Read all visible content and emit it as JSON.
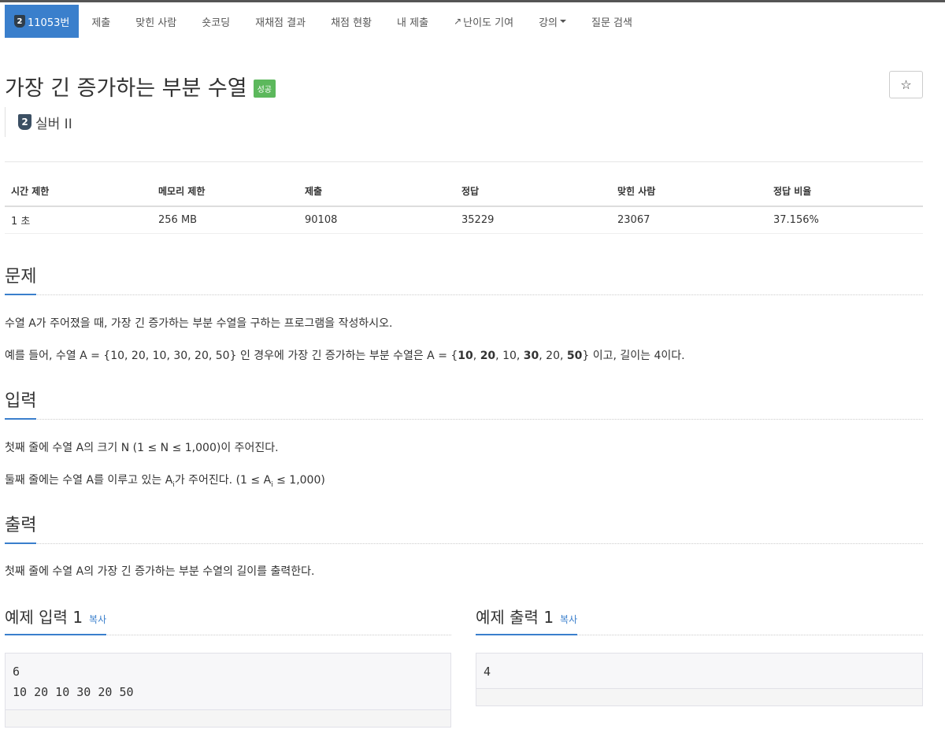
{
  "nav": {
    "problem_id": "11053번",
    "tier_num": "2",
    "items": [
      "제출",
      "맞힌 사람",
      "숏코딩",
      "재채점 결과",
      "채점 현황",
      "내 제출",
      "난이도 기여",
      "강의",
      "질문 검색"
    ]
  },
  "problem": {
    "title": "가장 긴 증가하는 부분 수열",
    "status_label": "성공",
    "star": "☆",
    "tier_num": "2",
    "tier_name": "실버 II"
  },
  "stats": {
    "headers": [
      "시간 제한",
      "메모리 제한",
      "제출",
      "정답",
      "맞힌 사람",
      "정답 비율"
    ],
    "values": [
      "1 초",
      "256 MB",
      "90108",
      "35229",
      "23067",
      "37.156%"
    ]
  },
  "sections": {
    "problem_title": "문제",
    "problem_p1": "수열 A가 주어졌을 때, 가장 긴 증가하는 부분 수열을 구하는 프로그램을 작성하시오.",
    "problem_p2_a": "예를 들어, 수열 A = {10, 20, 10, 30, 20, 50} 인 경우에 가장 긴 증가하는 부분 수열은 A = {",
    "problem_p2_b1": "10",
    "problem_p2_s1": ", ",
    "problem_p2_b2": "20",
    "problem_p2_s2": ", 10, ",
    "problem_p2_b3": "30",
    "problem_p2_s3": ", 20, ",
    "problem_p2_b4": "50",
    "problem_p2_c": "} 이고, 길이는 4이다.",
    "input_title": "입력",
    "input_p1": "첫째 줄에 수열 A의 크기 N (1 ≤ N ≤ 1,000)이 주어진다.",
    "input_p2_a": "둘째 줄에는 수열 A를 이루고 있는 A",
    "input_p2_sub": "i",
    "input_p2_b": "가 주어진다. (1 ≤ A",
    "input_p2_sub2": "i",
    "input_p2_c": " ≤ 1,000)",
    "output_title": "출력",
    "output_p1": "첫째 줄에 수열 A의 가장 긴 증가하는 부분 수열의 길이를 출력한다."
  },
  "samples": {
    "input_title": "예제 입력 1",
    "output_title": "예제 출력 1",
    "copy_label": "복사",
    "input_text": "6\n10 20 10 30 20 50",
    "output_text": "4"
  }
}
